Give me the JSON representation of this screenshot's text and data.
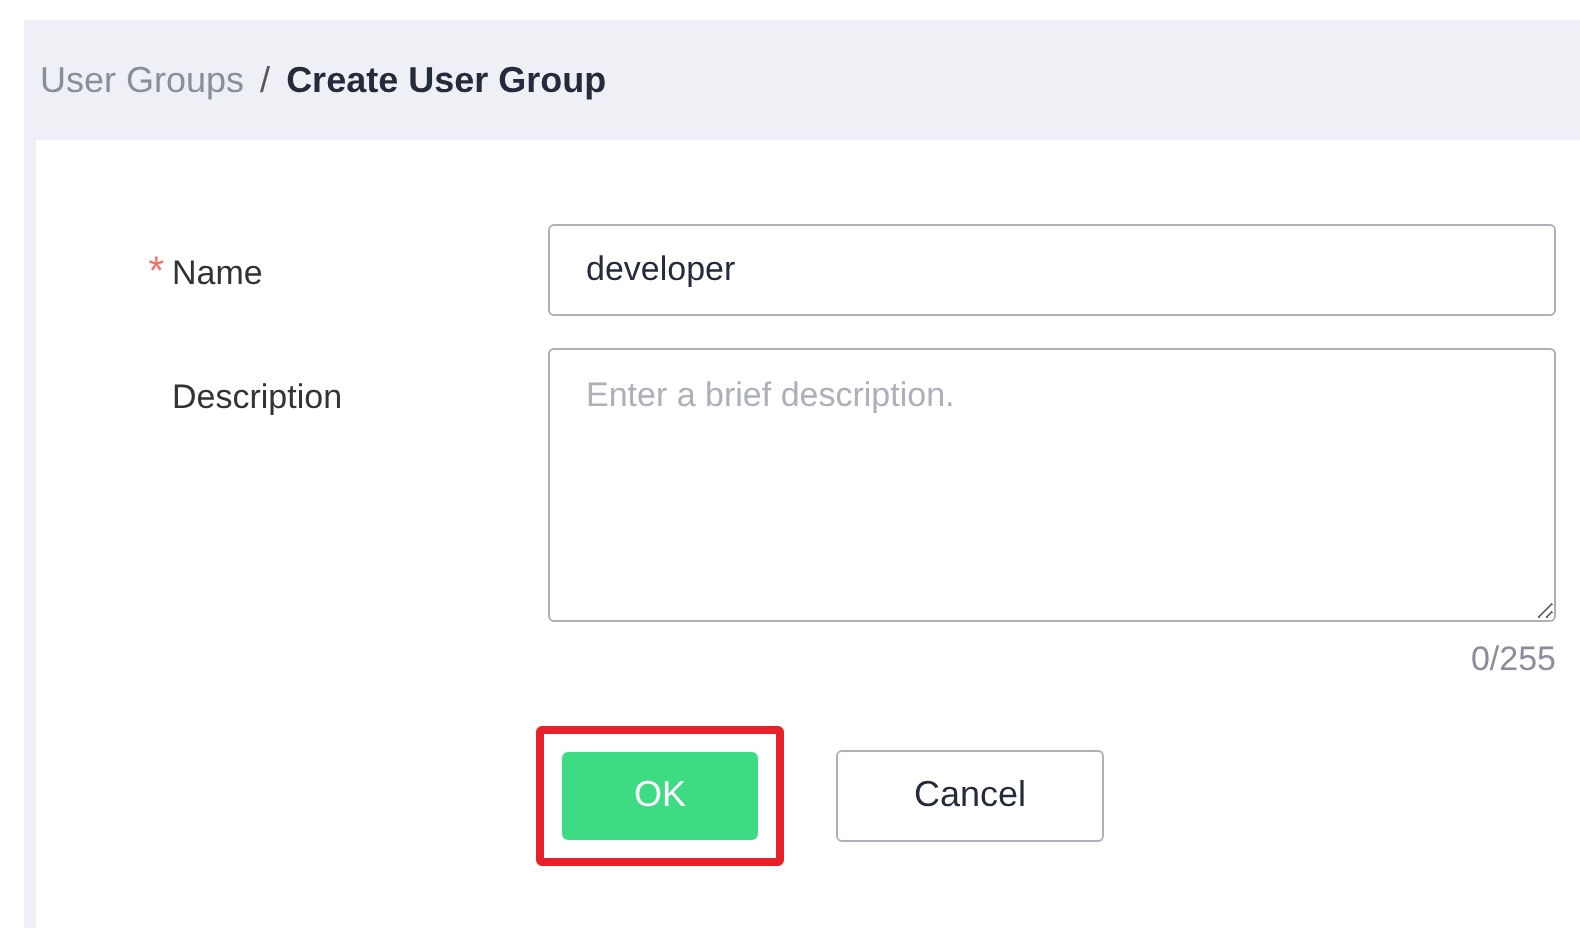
{
  "breadcrumb": [
    {
      "label": "User Groups",
      "current": false
    },
    {
      "label": "Create User Group",
      "current": true
    }
  ],
  "separator": "/",
  "fields": [
    {
      "kind": "input",
      "label": "Name",
      "required_mark": "*",
      "value": "developer"
    },
    {
      "kind": "textarea",
      "label": "Description",
      "placeholder": "Enter a brief description.",
      "counter": "0/255"
    }
  ],
  "buttons": [
    {
      "label": "OK",
      "kind": "primary",
      "highlighted": true
    },
    {
      "label": "Cancel",
      "kind": "secondary",
      "highlighted": false
    }
  ]
}
